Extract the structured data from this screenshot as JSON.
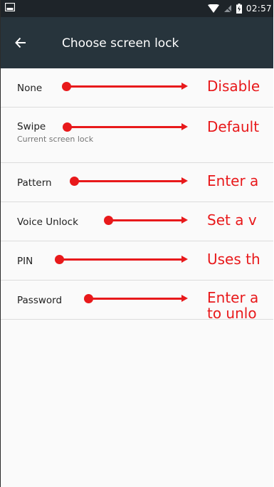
{
  "status_bar": {
    "time": "02:57",
    "icons": [
      "notification-icon",
      "wifi-icon",
      "no-sim-icon",
      "battery-icon"
    ]
  },
  "app_bar": {
    "title": "Choose screen lock",
    "back_icon": "back-arrow-icon"
  },
  "options": [
    {
      "title": "None",
      "subtitle": "",
      "annotation": [
        "Disable"
      ]
    },
    {
      "title": "Swipe",
      "subtitle": "Current screen lock",
      "annotation": [
        "Default"
      ]
    },
    {
      "title": "Pattern",
      "subtitle": "",
      "annotation": [
        "Enter a"
      ]
    },
    {
      "title": "Voice Unlock",
      "subtitle": "",
      "annotation": [
        "Set a v"
      ]
    },
    {
      "title": "PIN",
      "subtitle": "",
      "annotation": [
        "Uses th"
      ]
    },
    {
      "title": "Password",
      "subtitle": "",
      "annotation": [
        "Enter a",
        "to unlo"
      ]
    }
  ],
  "colors": {
    "status_bar": "#1e2429",
    "app_bar": "#27343c",
    "annotation": "#e8191b",
    "background": "#fafafa"
  }
}
